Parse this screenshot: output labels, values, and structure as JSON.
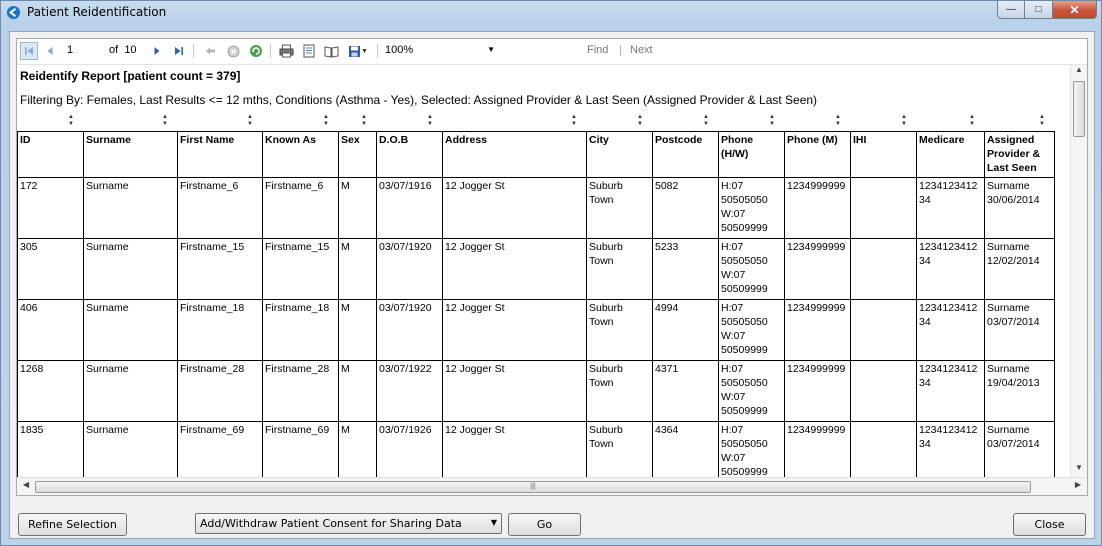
{
  "window": {
    "title": "Patient Reidentification",
    "minimize_glyph": "—",
    "maximize_glyph": "□",
    "close_glyph": "✕"
  },
  "toolbar": {
    "first_icon": "first-page-icon",
    "prev_icon": "previous-page-icon",
    "page_value": "1",
    "of_label": "of",
    "total_pages": "10",
    "next_icon": "next-page-icon",
    "last_icon": "last-page-icon",
    "zoom_value": "100%",
    "find_label": "Find",
    "find_separator": "|",
    "next_label": "Next"
  },
  "report": {
    "title": "Reidentify Report  [patient count = 379]",
    "filter": "Filtering By: Females, Last Results <= 12 mths, Conditions (Asthma - Yes), Selected: Assigned Provider & Last Seen (Assigned Provider & Last Seen)",
    "columns": [
      "ID",
      "Surname",
      "First Name",
      "Known As",
      "Sex",
      "D.O.B",
      "Address",
      "City",
      "Postcode",
      "Phone (H/W)",
      "Phone (M)",
      "IHI",
      "Medicare",
      "Assigned Provider & Last Seen"
    ],
    "rows": [
      [
        "172",
        "Surname",
        "Firstname_6",
        "Firstname_6",
        "M",
        "03/07/1916",
        "12 Jogger St",
        "Suburb Town",
        "5082",
        "H:07 50505050 W:07 50509999",
        "1234999999",
        "",
        "1234123412 34",
        "Surname 30/06/2014"
      ],
      [
        "305",
        "Surname",
        "Firstname_15",
        "Firstname_15",
        "M",
        "03/07/1920",
        "12 Jogger St",
        "Suburb Town",
        "5233",
        "H:07 50505050 W:07 50509999",
        "1234999999",
        "",
        "1234123412 34",
        "Surname 12/02/2014"
      ],
      [
        "406",
        "Surname",
        "Firstname_18",
        "Firstname_18",
        "M",
        "03/07/1920",
        "12 Jogger St",
        "Suburb Town",
        "4994",
        "H:07 50505050 W:07 50509999",
        "1234999999",
        "",
        "1234123412 34",
        "Surname 03/07/2014"
      ],
      [
        "1268",
        "Surname",
        "Firstname_28",
        "Firstname_28",
        "M",
        "03/07/1922",
        "12 Jogger St",
        "Suburb Town",
        "4371",
        "H:07 50505050 W:07 50509999",
        "1234999999",
        "",
        "1234123412 34",
        "Surname 19/04/2013"
      ],
      [
        "1835",
        "Surname",
        "Firstname_69",
        "Firstname_69",
        "M",
        "03/07/1926",
        "12 Jogger St",
        "Suburb Town",
        "4364",
        "H:07 50505050 W:07 50509999",
        "1234999999",
        "",
        "1234123412 34",
        "Surname 03/07/2014"
      ]
    ]
  },
  "buttons": {
    "refine": "Refine Selection",
    "consent_select": "Add/Withdraw Patient Consent for Sharing Data",
    "go": "Go",
    "close": "Close"
  },
  "colors": {
    "window_frame": "#b9d0e8",
    "close_button": "#c8553b",
    "toolbar_icon": "#2b63b8"
  }
}
